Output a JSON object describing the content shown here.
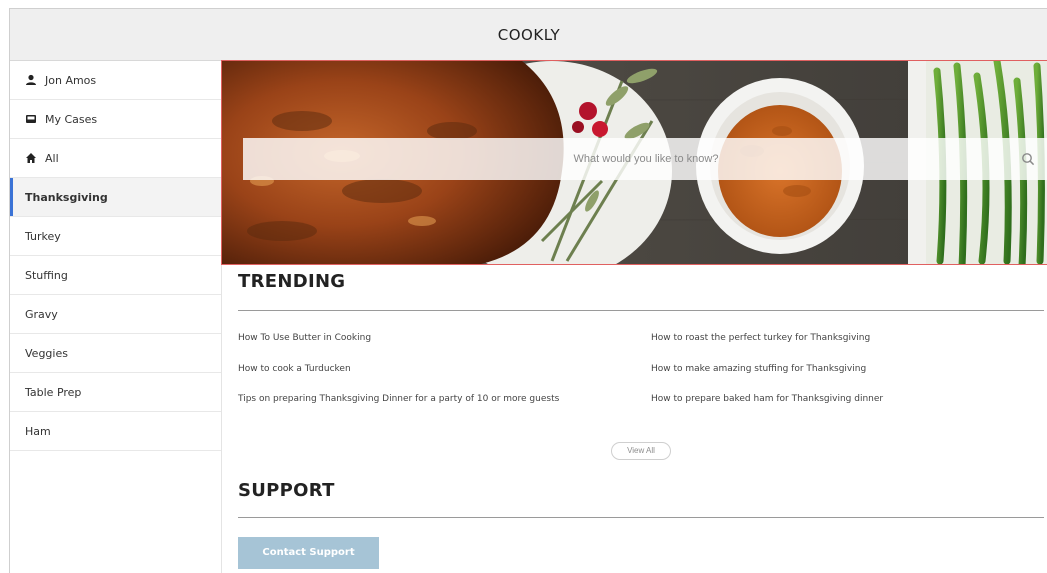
{
  "header": {
    "title": "COOKLY"
  },
  "sidebar": {
    "user": {
      "label": "Jon Amos",
      "icon": "user-icon"
    },
    "cases": {
      "label": "My Cases",
      "icon": "inbox-icon"
    },
    "all": {
      "label": "All",
      "icon": "home-icon"
    },
    "categories": [
      "Thanksgiving",
      "Turkey",
      "Stuffing",
      "Gravy",
      "Veggies",
      "Table Prep",
      "Ham"
    ],
    "active": "Thanksgiving",
    "accent": "#3b73d6"
  },
  "search": {
    "placeholder": "What would you like to know?",
    "icon": "search-icon"
  },
  "trending": {
    "title": "TRENDING",
    "left": [
      "How To Use Butter in Cooking",
      "How to cook a Turducken",
      "Tips on preparing Thanksgiving Dinner for a party of 10 or more guests"
    ],
    "right": [
      "How to roast the perfect turkey for Thanksgiving",
      "How to make amazing stuffing for Thanksgiving",
      "How to prepare baked ham for Thanksgiving dinner"
    ],
    "view_all": "View All"
  },
  "support": {
    "title": "SUPPORT",
    "button": "Contact Support",
    "button_color": "#a6c4d6"
  },
  "hero": {
    "highlight_color": "#e06060"
  }
}
